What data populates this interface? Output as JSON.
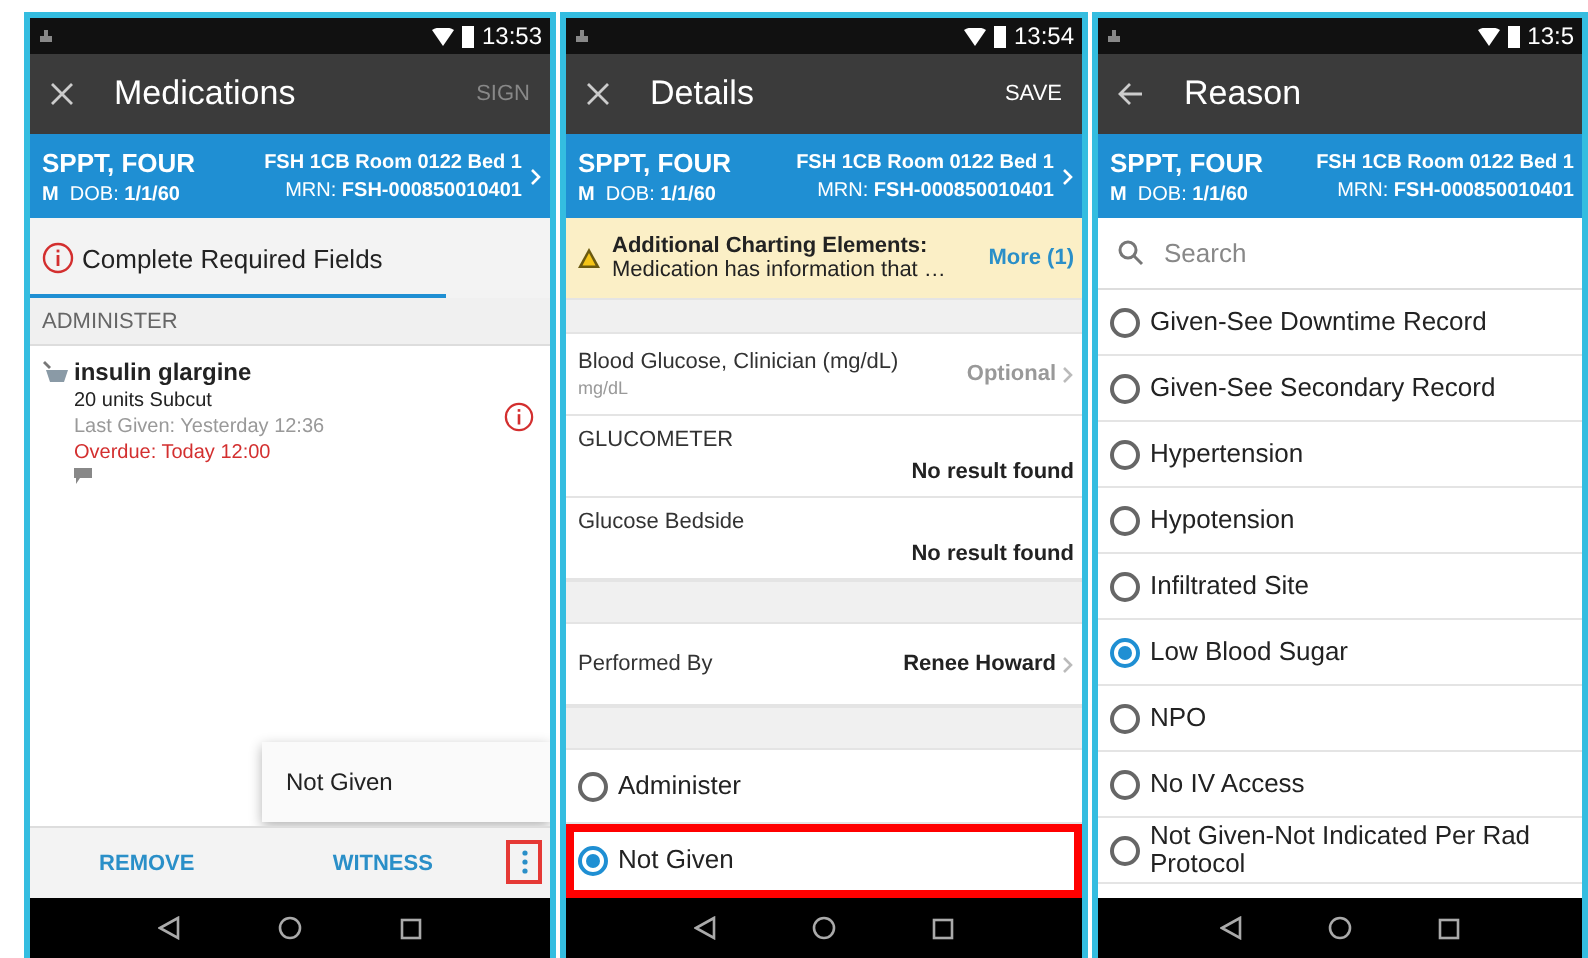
{
  "screens": [
    {
      "kind": "medications",
      "status_time": "13:53",
      "toolbar": {
        "kind": "close",
        "title": "Medications",
        "action": "SIGN",
        "disabled": true
      },
      "patient": {
        "name": "SPPT, FOUR",
        "sex": "M",
        "dob_label": "DOB:",
        "dob": "1/1/60",
        "location": "FSH 1CB Room 0122 Bed 1",
        "mrn_label": "MRN:",
        "mrn": "FSH-000850010401",
        "chevron": true
      },
      "required": {
        "text": "Complete Required Fields",
        "level": 0.8
      },
      "section": "ADMINISTER",
      "medication": {
        "name": "insulin glargine",
        "dose": "20 units Subcut",
        "last_given": "Last Given: Yesterday 12:36",
        "overdue": "Overdue: Today 12:00"
      },
      "menu": [
        "Not Given"
      ],
      "bottom_bar": {
        "buttons": [
          "REMOVE",
          "WITNESS"
        ],
        "more_highlighted": true
      }
    },
    {
      "kind": "details",
      "status_time": "13:54",
      "toolbar": {
        "kind": "close",
        "title": "Details",
        "action": "SAVE",
        "disabled": false
      },
      "patient": {
        "name": "SPPT, FOUR",
        "sex": "M",
        "dob_label": "DOB:",
        "dob": "1/1/60",
        "location": "FSH 1CB Room 0122 Bed 1",
        "mrn_label": "MRN:",
        "mrn": "FSH-000850010401",
        "chevron": true
      },
      "warning": {
        "title": "Additional Charting Elements:",
        "text": "Medication has information that …",
        "link": "More (1)"
      },
      "sections": [
        [
          {
            "kind": "optional",
            "label": "Blood Glucose, Clinician (mg/dL)",
            "unit": "mg/dL",
            "value": "Optional"
          },
          {
            "kind": "result",
            "label": "GLUCOMETER",
            "value": "No result found"
          },
          {
            "kind": "result",
            "label": "Glucose Bedside",
            "value": "No result found"
          }
        ],
        [
          {
            "kind": "link",
            "label": "Performed By",
            "value": "Renee Howard"
          }
        ]
      ],
      "options": [
        {
          "label": "Administer",
          "selected": false,
          "highlighted": false
        },
        {
          "label": "Not Given",
          "selected": true,
          "highlighted": true
        }
      ]
    },
    {
      "kind": "reason",
      "status_time": "13:5",
      "toolbar": {
        "kind": "back",
        "title": "Reason"
      },
      "patient": {
        "name": "SPPT, FOUR",
        "sex": "M",
        "dob_label": "DOB:",
        "dob": "1/1/60",
        "location": "FSH 1CB Room 0122 Bed 1",
        "mrn_label": "MRN:",
        "mrn": "FSH-000850010401",
        "chevron": false
      },
      "search": {
        "placeholder": "Search"
      },
      "options": [
        {
          "label": "Given-See Downtime Record",
          "selected": false
        },
        {
          "label": "Given-See Secondary Record",
          "selected": false
        },
        {
          "label": "Hypertension",
          "selected": false
        },
        {
          "label": "Hypotension",
          "selected": false
        },
        {
          "label": "Infiltrated Site",
          "selected": false
        },
        {
          "label": "Low Blood Sugar",
          "selected": true
        },
        {
          "label": "NPO",
          "selected": false
        },
        {
          "label": "No IV Access",
          "selected": false
        },
        {
          "label": "Not Given-Not Indicated Per Rad Protocol",
          "selected": false
        }
      ]
    }
  ]
}
